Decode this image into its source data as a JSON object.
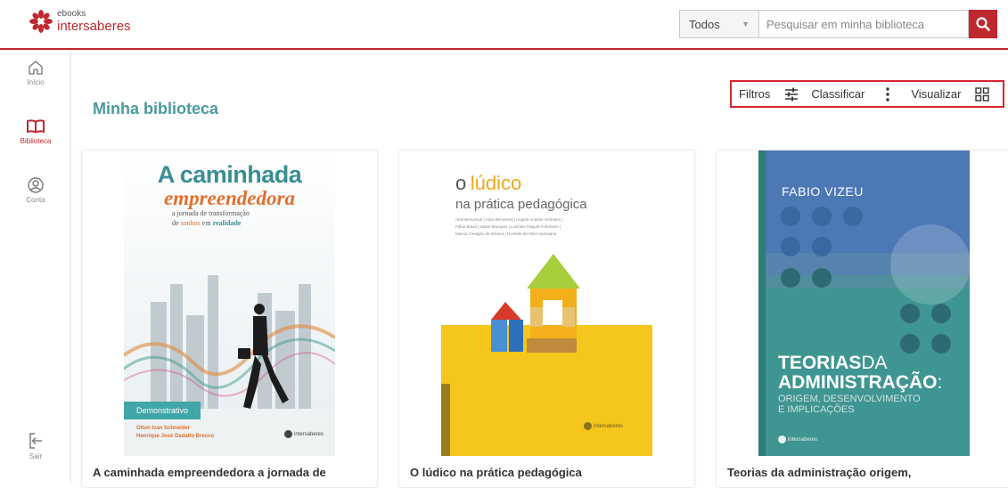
{
  "header": {
    "logo_small": "ebooks",
    "logo_big": "intersaberes",
    "filter_select": "Todos",
    "search_placeholder": "Pesquisar em minha biblioteca",
    "search_icon": "search-icon"
  },
  "sidebar": {
    "items": [
      {
        "label": "Início",
        "icon": "home-icon"
      },
      {
        "label": "Biblioteca",
        "icon": "book-icon",
        "active": true
      },
      {
        "label": "Conta",
        "icon": "account-icon"
      },
      {
        "label": "Sair",
        "icon": "logout-icon"
      }
    ]
  },
  "main": {
    "title": "Minha biblioteca",
    "toolbar": {
      "filters_label": "Filtros",
      "sort_label": "Classificar",
      "view_label": "Visualizar"
    }
  },
  "books": [
    {
      "title": "A caminhada empreendedora a jornada de",
      "cover": {
        "line1": "A caminhada",
        "line2": "empreendedora",
        "sub1": "a jornada de transformação",
        "sub2a": "de",
        "sub2b": "sonhos",
        "sub2c": "em",
        "sub2d": "realidade",
        "badge": "Demonstrativo",
        "author1": "Olton Ivan Schneider",
        "author2": "Henrique José Dadalto Brecco",
        "publisher": "intersaberes"
      }
    },
    {
      "title": "O lúdico na prática pedagógica",
      "cover": {
        "o": "o",
        "ludico": "lúdico",
        "subtitle": "na prática pedagógica",
        "authors1": "Abel Benvenuti | Alice Benvenuti | Angela Ariadne Hofmann |",
        "authors2": "Fábio Brasil | Isabel Marques | Lucinéia Raquel Fuhrmann |",
        "authors3": "Marcia Castiglio da Silveira | Rochele da Silva Santaiana",
        "publisher": "intersaberes"
      }
    },
    {
      "title": "Teorias da administração origem,",
      "cover": {
        "author": "FABIO VIZEU",
        "t1a": "TEORIAS",
        "t1b": "DA",
        "t2": "ADMINISTRAÇÃO",
        "t2b": ":",
        "s1": "ORIGEM, DESENVOLVIMENTO",
        "s2": "E IMPLICAÇÕES",
        "publisher": "intersaberes"
      }
    }
  ],
  "colors": {
    "brand_red": "#c0282f",
    "title_teal": "#4a9a9e"
  }
}
